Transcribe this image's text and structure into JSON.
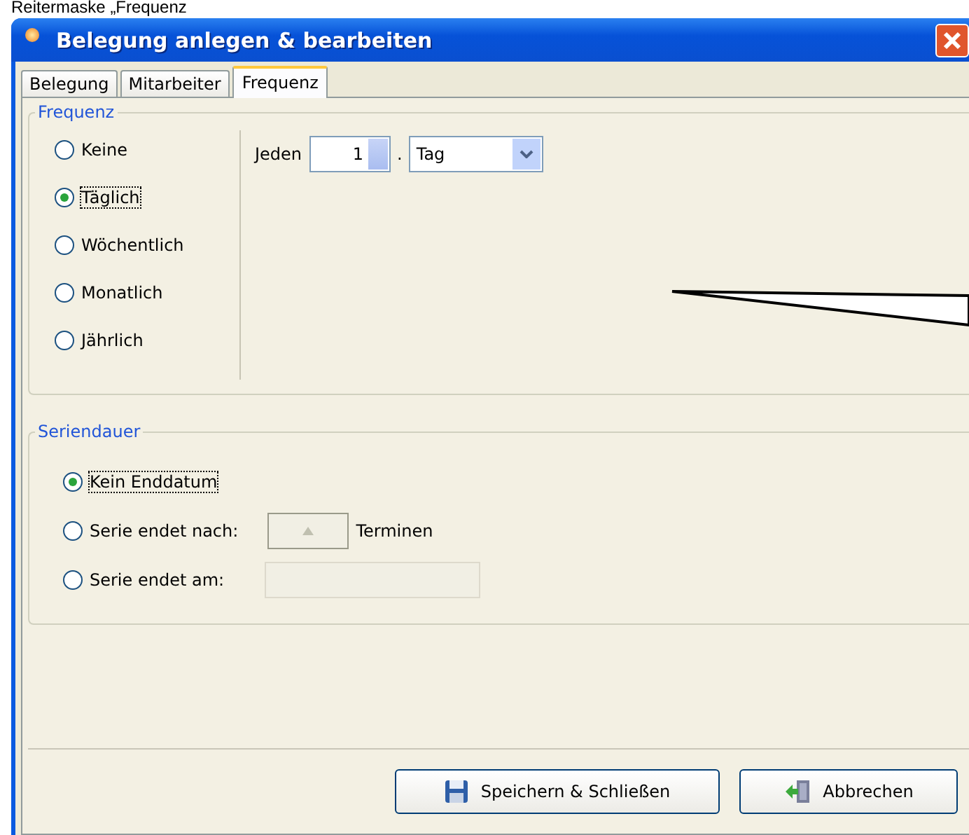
{
  "caption": "Reitermaske „Frequenz",
  "window": {
    "title": "Belegung anlegen & bearbeiten"
  },
  "tabs": [
    {
      "label": "Belegung",
      "selected": false
    },
    {
      "label": "Mitarbeiter",
      "selected": false
    },
    {
      "label": "Frequenz",
      "selected": true
    }
  ],
  "frequency": {
    "title": "Frequenz",
    "options": [
      {
        "label": "Keine",
        "selected": false
      },
      {
        "label": "Täglich",
        "selected": true
      },
      {
        "label": "Wöchentlich",
        "selected": false
      },
      {
        "label": "Monatlich",
        "selected": false
      },
      {
        "label": "Jährlich",
        "selected": false
      }
    ],
    "every_label": "Jeden",
    "every_value": "1",
    "separator": ".",
    "unit": "Tag"
  },
  "duration": {
    "title": "Seriendauer",
    "options": [
      {
        "label": "Kein Enddatum",
        "selected": true,
        "kind": "plain"
      },
      {
        "label": "Serie endet nach:",
        "selected": false,
        "kind": "count",
        "suffix": "Terminen"
      },
      {
        "label": "Serie endet am:",
        "selected": false,
        "kind": "date"
      }
    ]
  },
  "buttons": [
    {
      "label": "Speichern & Schließen",
      "kind": "save"
    },
    {
      "label": "Abbrechen",
      "kind": "cancel"
    }
  ]
}
